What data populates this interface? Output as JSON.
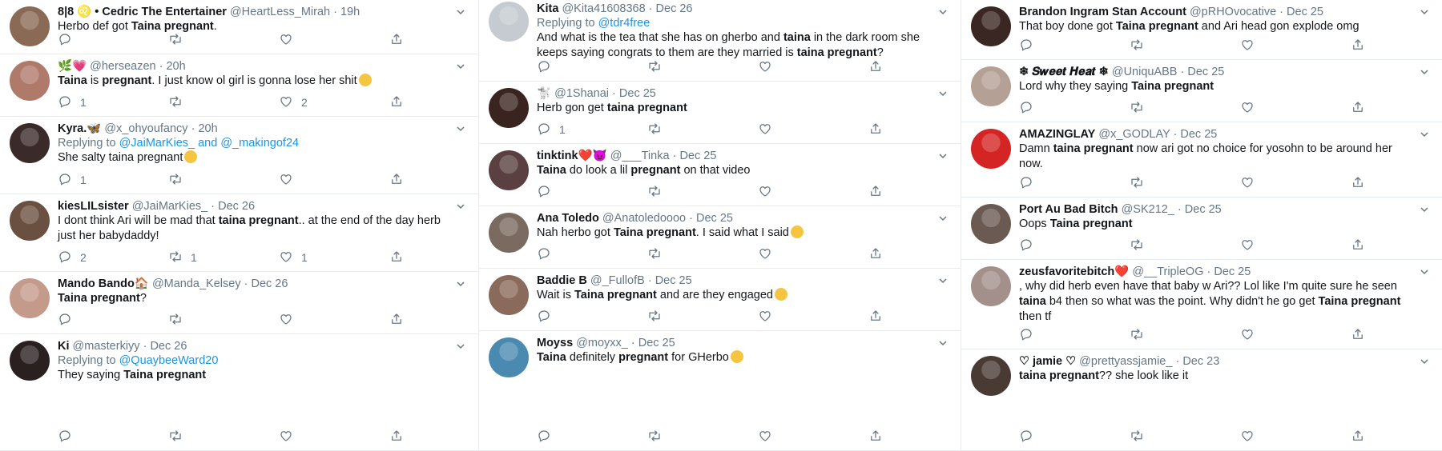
{
  "columns": [
    {
      "tweets": [
        {
          "name": "8|8 ♌ • Cedric The Entertainer",
          "handle": "@HeartLess_Mirah",
          "time": "19h",
          "reply_to": [],
          "body": [
            [
              "Herbo def got ",
              ""
            ],
            [
              "Taina pregnant",
              "b"
            ],
            [
              ".",
              ""
            ]
          ],
          "emoji": "",
          "counts": [
            "",
            "",
            "",
            ""
          ]
        },
        {
          "name": "🌿💗",
          "handle": "@herseazen",
          "time": "20h",
          "reply_to": [],
          "body": [
            [
              "Taina",
              "b"
            ],
            [
              " is ",
              ""
            ],
            [
              "pregnant",
              "b"
            ],
            [
              ". I just know ol girl is gonna lose her shit",
              ""
            ]
          ],
          "emoji": "#f5c542",
          "counts": [
            "1",
            "",
            "2",
            ""
          ]
        },
        {
          "name": "Kyra.🦋",
          "handle": "@x_ohyoufancy",
          "time": "20h",
          "reply_to": [
            "@JaiMarKies_ and @_makingof24"
          ],
          "body": [
            [
              "She salty taina pregnant",
              ""
            ]
          ],
          "emoji": "#f5c542",
          "counts": [
            "1",
            "",
            "",
            ""
          ]
        },
        {
          "name": "kiesLILsister",
          "handle": "@JaiMarKies_",
          "time": "Dec 26",
          "reply_to": [],
          "body": [
            [
              "I dont think Ari will be mad that ",
              ""
            ],
            [
              "taina pregnant",
              "b"
            ],
            [
              ".. at the end of the day herb just her babydaddy!",
              ""
            ]
          ],
          "emoji": "",
          "counts": [
            "2",
            "1",
            "1",
            ""
          ]
        },
        {
          "name": "Mando Bando🏠",
          "handle": "@Manda_Kelsey",
          "time": "Dec 26",
          "reply_to": [],
          "body": [
            [
              "Taina pregnant",
              "b"
            ],
            [
              "?",
              ""
            ]
          ],
          "emoji": "",
          "counts": [
            "",
            "",
            "",
            ""
          ]
        },
        {
          "name": "Ki",
          "handle": "@masterkiyy",
          "time": "Dec 26",
          "reply_to": [
            "@QuaybeeWard20"
          ],
          "body": [
            [
              "They saying ",
              ""
            ],
            [
              "Taina pregnant",
              "b"
            ]
          ],
          "emoji": "",
          "counts": [
            "",
            "",
            "",
            ""
          ]
        }
      ]
    },
    {
      "tweets": [
        {
          "name": "Kita",
          "handle": "@Kita41608368",
          "time": "Dec 26",
          "reply_to": [
            "@tdr4free"
          ],
          "body": [
            [
              "And what is the tea that she has on gherbo and ",
              ""
            ],
            [
              "taina",
              "b"
            ],
            [
              " in the dark room she keeps saying congrats to them are they married is ",
              ""
            ],
            [
              "taina pregnant",
              "b"
            ],
            [
              "?",
              ""
            ]
          ],
          "emoji": "",
          "counts": [
            "",
            "",
            "",
            ""
          ]
        },
        {
          "name": "🐩",
          "handle": "@1Shanai",
          "time": "Dec 25",
          "reply_to": [],
          "body": [
            [
              "Herb gon get ",
              ""
            ],
            [
              "taina pregnant",
              "b"
            ]
          ],
          "emoji": "",
          "counts": [
            "1",
            "",
            "",
            ""
          ]
        },
        {
          "name": "tinktink❤️😈",
          "handle": "@___Tinka",
          "time": "Dec 25",
          "reply_to": [],
          "body": [
            [
              "Taina",
              "b"
            ],
            [
              " do look a lil ",
              ""
            ],
            [
              "pregnant",
              "b"
            ],
            [
              " on that video",
              ""
            ]
          ],
          "emoji": "",
          "counts": [
            "",
            "",
            "",
            ""
          ]
        },
        {
          "name": "Ana Toledo",
          "handle": "@Anatoledoooo",
          "time": "Dec 25",
          "reply_to": [],
          "body": [
            [
              "Nah herbo got ",
              ""
            ],
            [
              "Taina pregnant",
              "b"
            ],
            [
              ". I said what I said",
              ""
            ]
          ],
          "emoji": "#f5c542",
          "counts": [
            "",
            "",
            "",
            ""
          ]
        },
        {
          "name": "Baddie B",
          "handle": "@_FullofB",
          "time": "Dec 25",
          "reply_to": [],
          "body": [
            [
              "Wait is ",
              ""
            ],
            [
              "Taina pregnant",
              "b"
            ],
            [
              " and are they engaged",
              ""
            ]
          ],
          "emoji": "#f5c542",
          "counts": [
            "",
            "",
            "",
            ""
          ]
        },
        {
          "name": "Moyss",
          "handle": "@moyxx_",
          "time": "Dec 25",
          "reply_to": [],
          "body": [
            [
              "Taina",
              "b"
            ],
            [
              " definitely ",
              ""
            ],
            [
              "pregnant",
              "b"
            ],
            [
              " for GHerbo",
              ""
            ]
          ],
          "emoji": "#f5c542",
          "counts": [
            "",
            "",
            "",
            ""
          ]
        }
      ]
    },
    {
      "tweets": [
        {
          "name": "Brandon Ingram Stan Account",
          "handle": "@pRHOvocative",
          "time": "Dec 25",
          "reply_to": [],
          "body": [
            [
              "That boy done got ",
              ""
            ],
            [
              "Taina pregnant",
              "b"
            ],
            [
              " and Ari head gon explode omg",
              ""
            ]
          ],
          "emoji": "",
          "counts": [
            "",
            "",
            "",
            ""
          ]
        },
        {
          "name": "❄ 𝑺𝒘𝒆𝒆𝒕 𝑯𝒆𝒂𝒕 ❄",
          "handle": "@UniquABB",
          "time": "Dec 25",
          "reply_to": [],
          "body": [
            [
              "Lord why they saying ",
              ""
            ],
            [
              "Taina pregnant",
              "b"
            ]
          ],
          "emoji": "",
          "counts": [
            "",
            "",
            "",
            ""
          ]
        },
        {
          "name": "AMAZINGLAY",
          "handle": "@x_GODLAY",
          "time": "Dec 25",
          "reply_to": [],
          "body": [
            [
              "Damn ",
              ""
            ],
            [
              "taina pregnant",
              "b"
            ],
            [
              " now ari got no choice for yosohn to be around her now.",
              ""
            ]
          ],
          "emoji": "",
          "counts": [
            "",
            "",
            "",
            ""
          ]
        },
        {
          "name": "Port Au Bad Bitch",
          "handle": "@SK212_",
          "time": "Dec 25",
          "reply_to": [],
          "body": [
            [
              "Oops ",
              ""
            ],
            [
              "Taina pregnant",
              "b"
            ]
          ],
          "emoji": "",
          "counts": [
            "",
            "",
            "",
            ""
          ]
        },
        {
          "name": "zeusfavoritebitch❤️",
          "handle": "@__TripleOG",
          "time": "Dec 25",
          "reply_to": [],
          "body": [
            [
              ", why did herb even have that baby w Ari?? Lol like I'm quite sure he seen ",
              ""
            ],
            [
              "taina",
              "b"
            ],
            [
              " b4 then so what was the point. Why didn't he go get ",
              ""
            ],
            [
              "Taina pregnant",
              "b"
            ],
            [
              " then tf",
              ""
            ]
          ],
          "emoji": "",
          "counts": [
            "",
            "",
            "",
            ""
          ]
        },
        {
          "name": "♡ jamie ♡",
          "handle": "@prettyassjamie_",
          "time": "Dec 23",
          "reply_to": [],
          "body": [
            [
              "taina pregnant",
              "b"
            ],
            [
              "?? she look like it",
              ""
            ]
          ],
          "emoji": "",
          "counts": [
            "",
            "",
            "",
            ""
          ]
        }
      ]
    }
  ],
  "labels": {
    "replying_to": "Replying to"
  },
  "colors": {
    "link": "#1b95e0",
    "muted": "#657786",
    "border": "#e6ecf0",
    "text": "#14171a"
  },
  "icons": [
    "reply-icon",
    "retweet-icon",
    "like-icon",
    "share-icon",
    "chevron-down-icon"
  ]
}
